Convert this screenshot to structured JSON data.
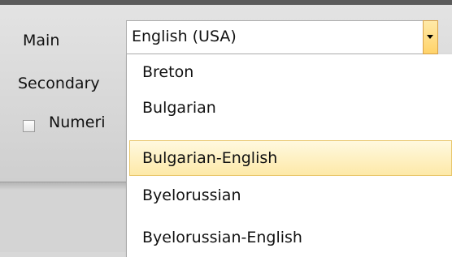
{
  "labels": {
    "main": "Main",
    "secondary": "Secondary",
    "numeric": "Numeri"
  },
  "main_combo": {
    "value": "English (USA)",
    "dropdown_icon": "chevron-down-icon"
  },
  "numeric_checkbox": {
    "checked": false
  },
  "dropdown_items": [
    {
      "label": "Breton"
    },
    {
      "label": "Bulgarian"
    },
    {
      "label": "Bulgarian-English",
      "selected": true
    },
    {
      "label": "Byelorussian"
    },
    {
      "label": "Byelorussian-English"
    }
  ],
  "colors": {
    "highlight": "#fde9a8",
    "highlight_border": "#e8c66a",
    "button": "#ffd36a"
  }
}
